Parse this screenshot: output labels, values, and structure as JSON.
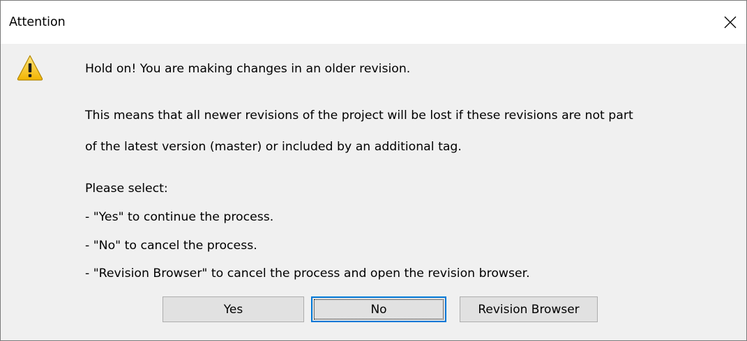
{
  "window": {
    "title": "Attention",
    "close_icon": "close-icon"
  },
  "icon": {
    "name": "warning-icon",
    "color": "#f5c518"
  },
  "message": {
    "line1": "Hold on! You are making changes in an older revision.",
    "line2": "This means that all newer revisions of the project will be lost if these revisions are not part",
    "line3": "of the latest version (master) or included by an additional tag.",
    "line4": "Please select:",
    "line5": "- \"Yes\" to continue the process.",
    "line6": "- \"No\" to cancel the process.",
    "line7": "- \"Revision Browser\" to cancel the process and open the revision browser."
  },
  "buttons": {
    "yes_label": "Yes",
    "no_label": "No",
    "revision_label": "Revision Browser",
    "focused": "No",
    "accent_color": "#0078d7"
  }
}
